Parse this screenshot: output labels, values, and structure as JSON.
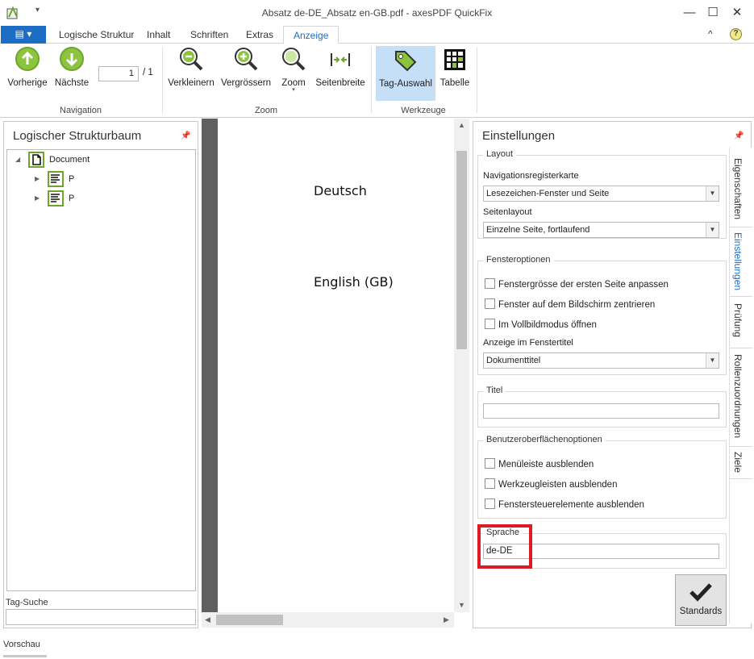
{
  "window": {
    "title": "Absatz de-DE_Absatz en-GB.pdf - axesPDF QuickFix",
    "minimize": "—",
    "maximize": "☐",
    "close": "✕"
  },
  "ribbon_tabs": {
    "file": "▤ ▾",
    "tabs": [
      "Logische Struktur",
      "Inhalt",
      "Schriften",
      "Extras",
      "Anzeige"
    ],
    "active": "Anzeige",
    "collapse": "^",
    "help": "?"
  },
  "ribbon": {
    "navigation": {
      "label": "Navigation",
      "prev": "Vorherige",
      "next": "Nächste",
      "page_value": "1",
      "page_total": "/ 1"
    },
    "zoom": {
      "label": "Zoom",
      "zoom_out": "Verkleinern",
      "zoom_in": "Vergrössern",
      "zoom": "Zoom",
      "page_width": "Seitenbreite"
    },
    "tools": {
      "label": "Werkzeuge",
      "tag_select": "Tag-Auswahl",
      "table": "Tabelle"
    }
  },
  "left_panel": {
    "title": "Logischer Strukturbaum",
    "tree": [
      {
        "label": "Document",
        "level": 0,
        "expanded": true
      },
      {
        "label": "P",
        "level": 1,
        "expanded": false
      },
      {
        "label": "P",
        "level": 1,
        "expanded": false
      }
    ],
    "tag_search_label": "Tag-Suche",
    "tag_search_value": ""
  },
  "document": {
    "lines": [
      "Deutsch",
      "English (GB)"
    ]
  },
  "right_panel": {
    "title": "Einstellungen",
    "side_tabs": [
      "Eigenschaften",
      "Einstellungen",
      "Prüfung",
      "Rollenzuordnungen",
      "Ziele"
    ],
    "active_side_tab": "Einstellungen",
    "layout": {
      "legend": "Layout",
      "nav_tab_label": "Navigationsregisterkarte",
      "nav_tab_value": "Lesezeichen-Fenster und Seite",
      "page_layout_label": "Seitenlayout",
      "page_layout_value": "Einzelne Seite, fortlaufend"
    },
    "window_options": {
      "legend": "Fensteroptionen",
      "checks": [
        "Fenstergrösse der ersten Seite anpassen",
        "Fenster auf dem Bildschirm zentrieren",
        "Im Vollbildmodus öffnen"
      ],
      "title_display_label": "Anzeige im Fenstertitel",
      "title_display_value": "Dokumenttitel"
    },
    "title_group": {
      "legend": "Titel",
      "value": ""
    },
    "ui_options": {
      "legend": "Benutzeroberflächenoptionen",
      "checks": [
        "Menüleiste ausblenden",
        "Werkzeugleisten ausblenden",
        "Fenstersteuerelemente ausblenden"
      ]
    },
    "language": {
      "legend": "Sprache",
      "value": "de-DE"
    },
    "defaults_button": "Standards"
  },
  "bottom_tab": "Vorschau",
  "colors": {
    "accent": "#1c6ec5",
    "highlight": "#e01a22",
    "icon_green": "#8cc43f",
    "selected_tool": "#c4dff6"
  }
}
